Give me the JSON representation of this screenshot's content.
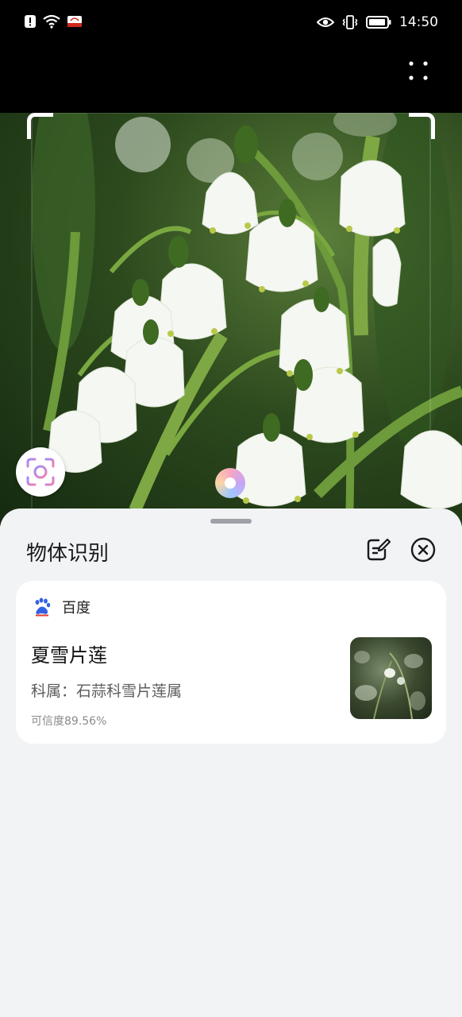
{
  "status_bar": {
    "time": "14:50",
    "left_icons": [
      "alert-icon",
      "wifi-icon",
      "carrier-badge-icon"
    ],
    "right_icons": [
      "eye-icon",
      "vibrate-icon",
      "battery-icon"
    ]
  },
  "topbar": {
    "more_icon": "more-grid-icon"
  },
  "camera": {
    "scan_icon": "scan-icon"
  },
  "sheet": {
    "title": "物体识别",
    "edit_icon": "edit-icon",
    "close_icon": "close-icon"
  },
  "result_card": {
    "source": {
      "name": "百度",
      "icon": "baidu-paw-icon"
    },
    "name": "夏雪片莲",
    "family": "科属：石蒜科雪片莲属",
    "confidence": "可信度89.56%"
  },
  "colors": {
    "sheet_bg": "#f1f3f5",
    "card_bg": "#ffffff",
    "baidu_blue": "#3360e6"
  }
}
